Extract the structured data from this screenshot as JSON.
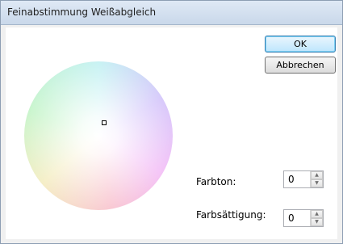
{
  "window": {
    "title": "Feinabstimmung Weißabgleich"
  },
  "buttons": {
    "ok_label": "OK",
    "cancel_label": "Abbrechen"
  },
  "fields": {
    "hue": {
      "label": "Farbton:",
      "value": "0"
    },
    "saturation": {
      "label": "Farbsättigung:",
      "value": "0"
    }
  },
  "icons": {
    "spin_up": "▲",
    "spin_down": "▼"
  }
}
